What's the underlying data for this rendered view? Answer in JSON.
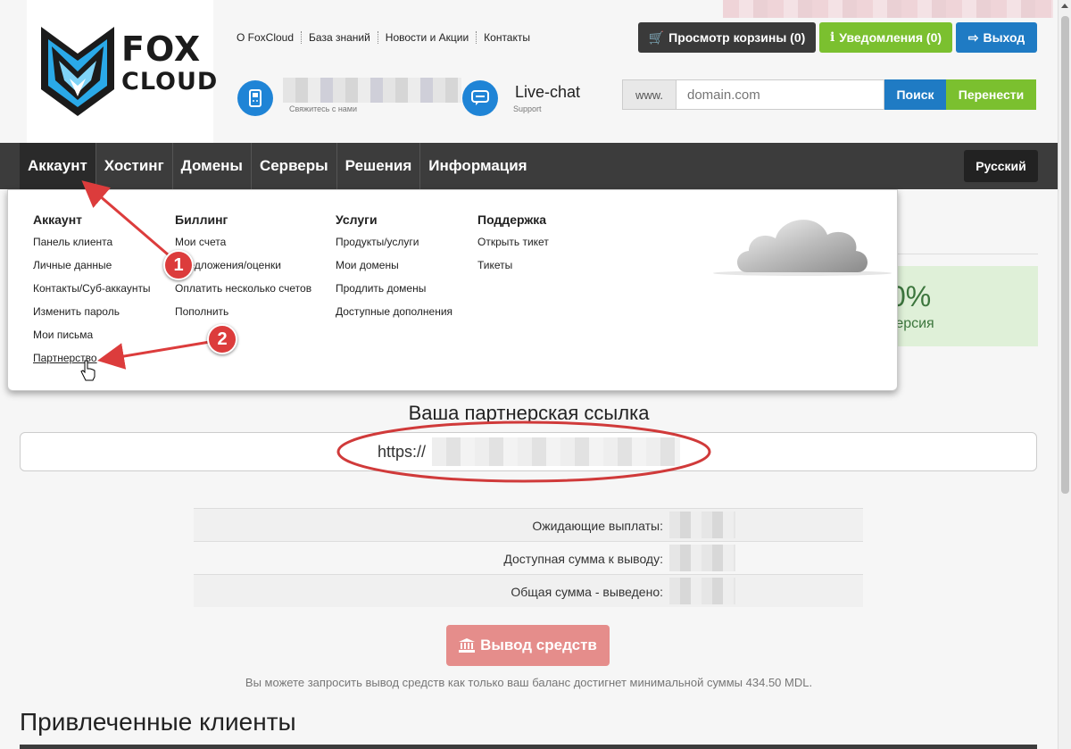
{
  "logo": {
    "line1": "FOX",
    "line2": "CLOUD"
  },
  "top_links": [
    "О FoxCloud",
    "База знаний",
    "Новости и Акции",
    "Контакты"
  ],
  "header_buttons": {
    "cart": "Просмотр корзины (0)",
    "notifications": "Уведомления (0)",
    "logout": "Выход"
  },
  "contact": {
    "phone_sub": "Свяжитесь с нами",
    "livechat": "Live-chat",
    "livechat_sub": "Support"
  },
  "search": {
    "prefix": "www.",
    "placeholder": "domain.com",
    "search_label": "Поиск",
    "transfer_label": "Перенести"
  },
  "nav": {
    "items": [
      "Аккаунт",
      "Хостинг",
      "Домены",
      "Серверы",
      "Решения",
      "Информация"
    ],
    "language": "Русский"
  },
  "dropdown": {
    "columns": [
      {
        "heading": "Аккаунт",
        "links": [
          "Панель клиента",
          "Личные данные",
          "Контакты/Суб-аккаунты",
          "Изменить пароль",
          "Мои письма",
          "Партнерство"
        ]
      },
      {
        "heading": "Биллинг",
        "links": [
          "Мои счета",
          "Предложения/оценки",
          "Оплатить несколько счетов",
          "Пополнить"
        ]
      },
      {
        "heading": "Услуги",
        "links": [
          "Продукты/услуги",
          "Мои домены",
          "Продлить домены",
          "Доступные дополнения"
        ]
      },
      {
        "heading": "Поддержка",
        "links": [
          "Открыть тикет",
          "Тикеты"
        ]
      }
    ]
  },
  "background_stat": {
    "value": "0%",
    "label": "версия"
  },
  "annotations": {
    "marker1": "1",
    "marker2": "2"
  },
  "partner": {
    "title": "Ваша партнерская ссылка",
    "link_prefix": "https://"
  },
  "stats": {
    "rows": [
      "Ожидающие выплаты:",
      "Доступная сумма к выводу:",
      "Общая сумма - выведено:"
    ]
  },
  "withdraw": {
    "button": "Вывод средств",
    "note": "Вы можете запросить вывод средств как только ваш баланс достигнет минимальной суммы 434.50 MDL."
  },
  "referred_clients_title": "Привлеченные клиенты",
  "colors": {
    "accent_blue": "#1f7bc4",
    "accent_green": "#7bc02f",
    "nav_dark": "#3c3c3c",
    "annotation_red": "#dc3c3c",
    "withdraw_red": "#e58d8b"
  }
}
